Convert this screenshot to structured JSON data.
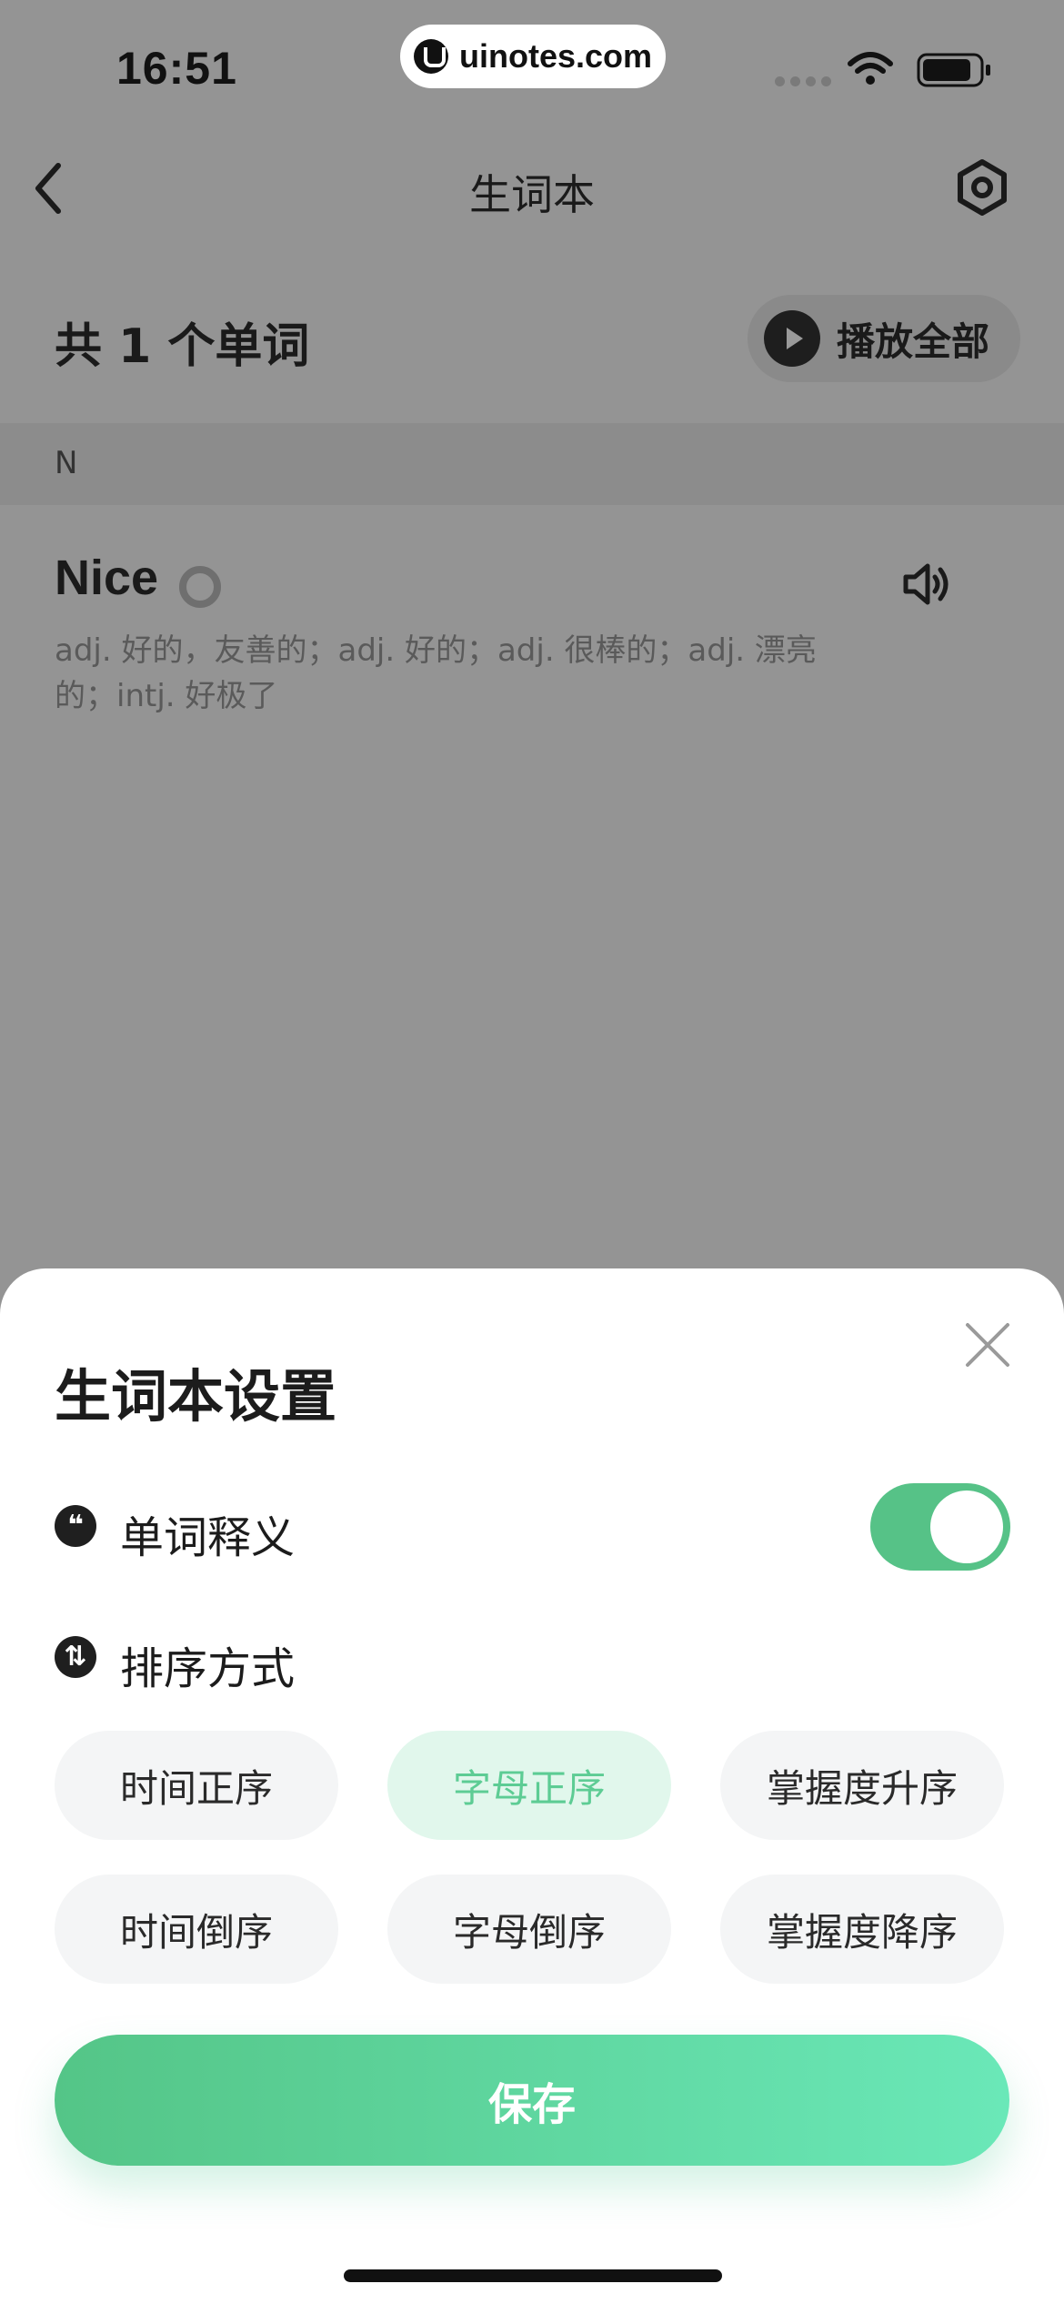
{
  "status_bar": {
    "time": "16:51",
    "url": "uinotes.com"
  },
  "nav": {
    "title": "生词本"
  },
  "summary": {
    "word_count": "共 1 个单词",
    "play_all": "播放全部"
  },
  "word_list": {
    "section_letter": "N",
    "items": [
      {
        "word": "Nice",
        "definition": "adj. 好的，友善的；adj. 好的；adj. 很棒的；adj. 漂亮的；intj. 好极了"
      }
    ]
  },
  "settings_sheet": {
    "title": "生词本设置",
    "show_definition_label": "单词释义",
    "show_definition_on": true,
    "sort_label": "排序方式",
    "sort_options": [
      "时间正序",
      "字母正序",
      "掌握度升序",
      "时间倒序",
      "字母倒序",
      "掌握度降序"
    ],
    "selected_sort": "字母正序",
    "save_label": "保存"
  },
  "colors": {
    "accent": "#56c287",
    "accent_light": "#e1f7ec",
    "overlay": "#949494"
  }
}
